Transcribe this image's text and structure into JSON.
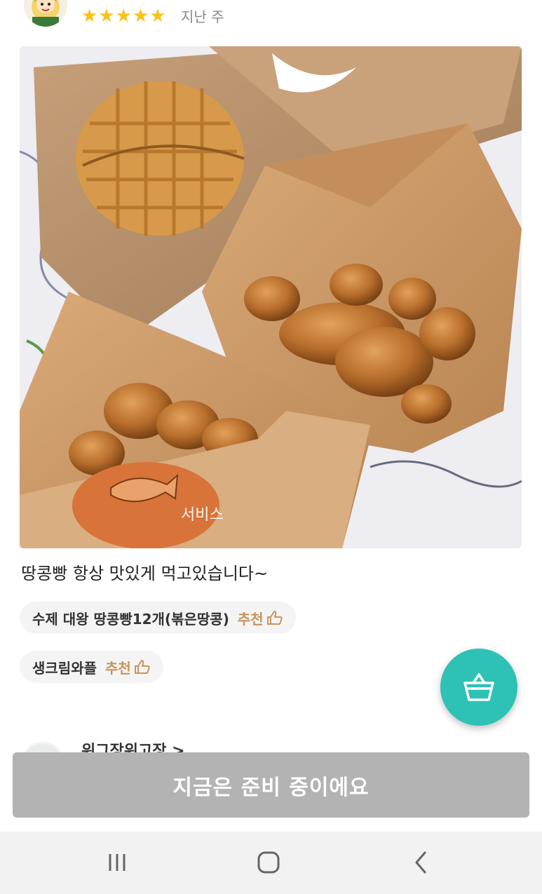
{
  "review": {
    "star_count": 5,
    "stars": [
      "★",
      "★",
      "★",
      "★",
      "★"
    ],
    "time_ago": "지난 주",
    "text": "땅콩빵 항상 맛있게 먹고있습니다~",
    "photo_sticker_text": "서비스",
    "menus": [
      {
        "name": "수제 대왕 땅콩빵12개(볶은땅콩)",
        "recommend": "추천"
      },
      {
        "name": "생크림와플",
        "recommend": "추천"
      }
    ]
  },
  "next_review": {
    "author": "위그장위고장 >"
  },
  "order_button": {
    "label": "지금은 준비 중이에요"
  },
  "icons": {
    "cart": "basket-icon",
    "thumb": "thumbs-up-icon",
    "nav_recent": "recent-apps-icon",
    "nav_home": "home-icon",
    "nav_back": "back-icon"
  },
  "colors": {
    "star": "#f7c21b",
    "recommend": "#c8945a",
    "fab": "#2ec1b6",
    "order_disabled": "#b3b3b3"
  }
}
